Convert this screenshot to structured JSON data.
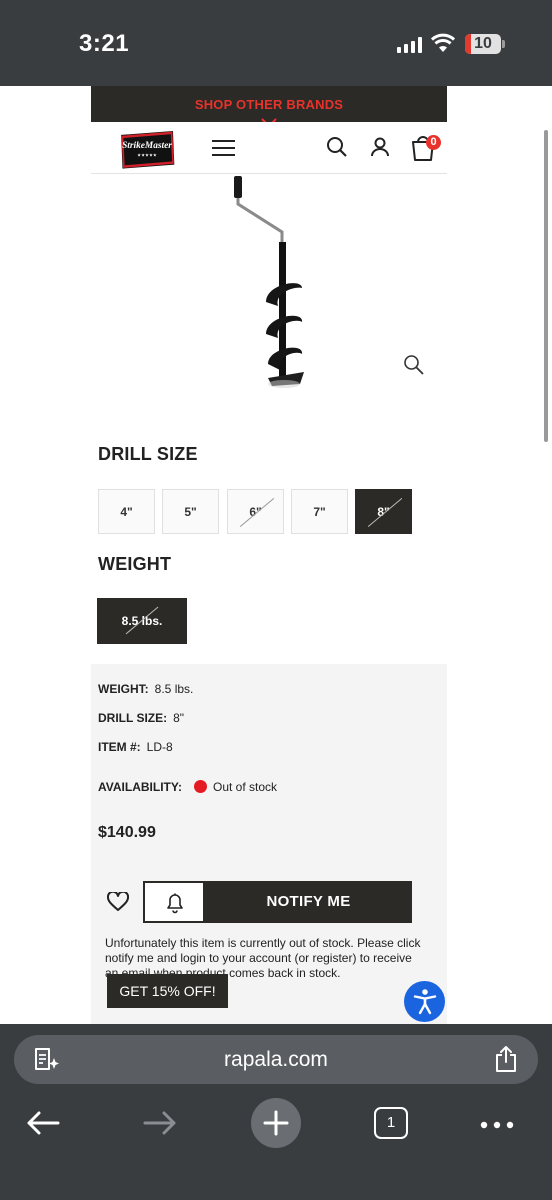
{
  "status_bar": {
    "time": "3:21",
    "battery": "10"
  },
  "header": {
    "brands_link": "SHOP OTHER BRANDS",
    "logo_text": "StrikeMaster",
    "cart_count": "0"
  },
  "product": {
    "image_name": "ice-auger-product-image"
  },
  "options": {
    "drill_size": {
      "title": "DRILL SIZE",
      "sizes": [
        {
          "label": "4\"",
          "available": true,
          "selected": false
        },
        {
          "label": "5\"",
          "available": true,
          "selected": false
        },
        {
          "label": "6\"",
          "available": false,
          "selected": false
        },
        {
          "label": "7\"",
          "available": true,
          "selected": false
        },
        {
          "label": "8\"",
          "available": false,
          "selected": true
        }
      ]
    },
    "weight": {
      "title": "WEIGHT",
      "value": "8.5 lbs."
    }
  },
  "details": {
    "weight_label": "WEIGHT:",
    "weight_value": "8.5 lbs.",
    "drill_size_label": "DRILL SIZE:",
    "drill_size_value": "8\"",
    "item_label": "ITEM #:",
    "item_value": "LD-8",
    "availability_label": "AVAILABILITY:",
    "availability_value": "Out of stock",
    "availability_color": "#e51b23",
    "price": "$140.99"
  },
  "actions": {
    "notify_label": "NOTIFY ME",
    "out_of_stock_message": "Unfortunately this item is currently out of stock. Please click notify me and login to your account (or register) to receive an email when product comes back in stock.",
    "promo_label": "GET 15% OFF!"
  },
  "browser": {
    "url": "rapala.com",
    "tab_count": "1"
  },
  "colors": {
    "brand_red": "#e8322b",
    "dark": "#2b2a26",
    "accessibility_blue": "#1a64e0"
  }
}
